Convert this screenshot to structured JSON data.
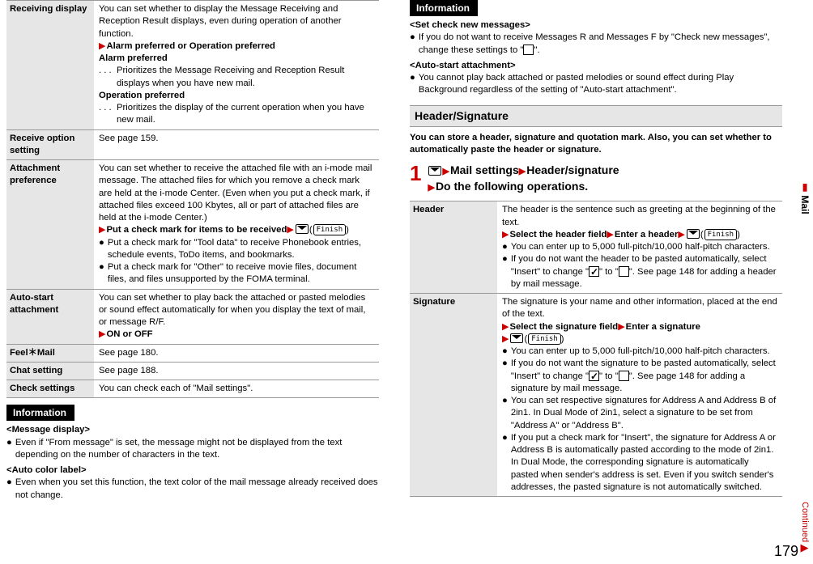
{
  "left_table": {
    "rows": [
      {
        "label": "Receiving display",
        "para1": "You can set whether to display the Message Receiving and Reception Result displays, even during operation of another function.",
        "action1": "Alarm preferred or Operation preferred",
        "sub1_title": "Alarm preferred",
        "sub1_dots": ". . .",
        "sub1_text": "Prioritizes the Message Receiving and Reception Result displays when you have new mail.",
        "sub2_title": "Operation preferred",
        "sub2_dots": ". . .",
        "sub2_text": "Prioritizes the display of the current operation when you have new mail."
      },
      {
        "label": "Receive option setting",
        "text": "See page 159."
      },
      {
        "label": "Attachment preference",
        "text1": "You can set whether to receive the attached file with an i-mode mail message. The attached files for which you remove a check mark are held at the i-mode Center. (Even when you put a check mark, if attached files exceed 100 Kbytes, all or part of attached files are held at the i-mode Center.)",
        "action": "Put a check mark for items to be received",
        "bullet1": "Put a check mark for \"Tool data\" to receive Phonebook entries, schedule events, ToDo items, and bookmarks.",
        "bullet2": "Put a check mark for \"Other\" to receive movie files, document files, and files unsupported by the FOMA terminal."
      },
      {
        "label": "Auto-start attachment",
        "text": "You can set whether to play back the attached or pasted melodies or sound effect automatically for when you display the text of mail, or message R/F.",
        "action": "ON or OFF"
      },
      {
        "label": "Feel＊Mail",
        "text": "See page 180."
      },
      {
        "label": "Chat setting",
        "text": "See page 188."
      },
      {
        "label": "Check settings",
        "text": "You can check each of \"Mail settings\"."
      }
    ]
  },
  "info_label": "Information",
  "left_info": {
    "h1": "<Message display>",
    "b1": "Even if \"From message\" is set, the message might not be displayed from the text depending on the number of characters in the text.",
    "h2": "<Auto color label>",
    "b2": "Even when you set this function, the text color of the mail message already received does not change."
  },
  "right_info": {
    "h1": "<Set check new messages>",
    "b1a": "If you do not want to receive Messages R and Messages F by \"Check new messages\", change these settings to \"",
    "b1b": "\".",
    "h2": "<Auto-start attachment>",
    "b2": "You cannot play back attached or pasted melodies or sound effect during Play Background regardless of the setting of \"Auto-start attachment\"."
  },
  "section_title": "Header/Signature",
  "section_intro": "You can store a header, signature and quotation mark. Also, you can set whether to automatically paste the header or signature.",
  "step_num": "1",
  "step_mail": "Mail settings",
  "step_hs": "Header/signature",
  "step_do": "Do the following operations.",
  "right_table": {
    "header": {
      "label": "Header",
      "text1": "The header is the sentence such as greeting at the beginning of the text.",
      "action": "Select the header field",
      "action2": "Enter a header",
      "b1": "You can enter up to 5,000 full-pitch/10,000 half-pitch characters.",
      "b2a": "If you do not want the header to be pasted automatically, select \"Insert\" to change \"",
      "b2b": "\" to \"",
      "b2c": "\". See page 148 for adding a header by mail message."
    },
    "signature": {
      "label": "Signature",
      "text1": "The signature is your name and other information, placed at the end of the text.",
      "action": "Select the signature field",
      "action2": "Enter a signature",
      "b1": "You can enter up to 5,000 full-pitch/10,000 half-pitch characters.",
      "b2a": "If you do not want the signature to be pasted automatically, select \"Insert\" to change \"",
      "b2b": "\" to \"",
      "b2c": "\". See page 148 for adding a signature by mail message.",
      "b3": "You can set respective signatures for Address A and Address B of 2in1. In Dual Mode of 2in1, select a signature to be set from \"Address A\" or \"Address B\".",
      "b4": "If you put a check mark for \"Insert\", the signature for Address A or Address B is automatically pasted according to the mode of 2in1. In Dual Mode, the corresponding signature is automatically pasted when sender's address is set. Even if you switch sender's addresses, the pasted signature is not automatically switched."
    }
  },
  "finish_label": "Finish",
  "side_tab": "Mail",
  "continued": "Continued",
  "page_number": "179"
}
